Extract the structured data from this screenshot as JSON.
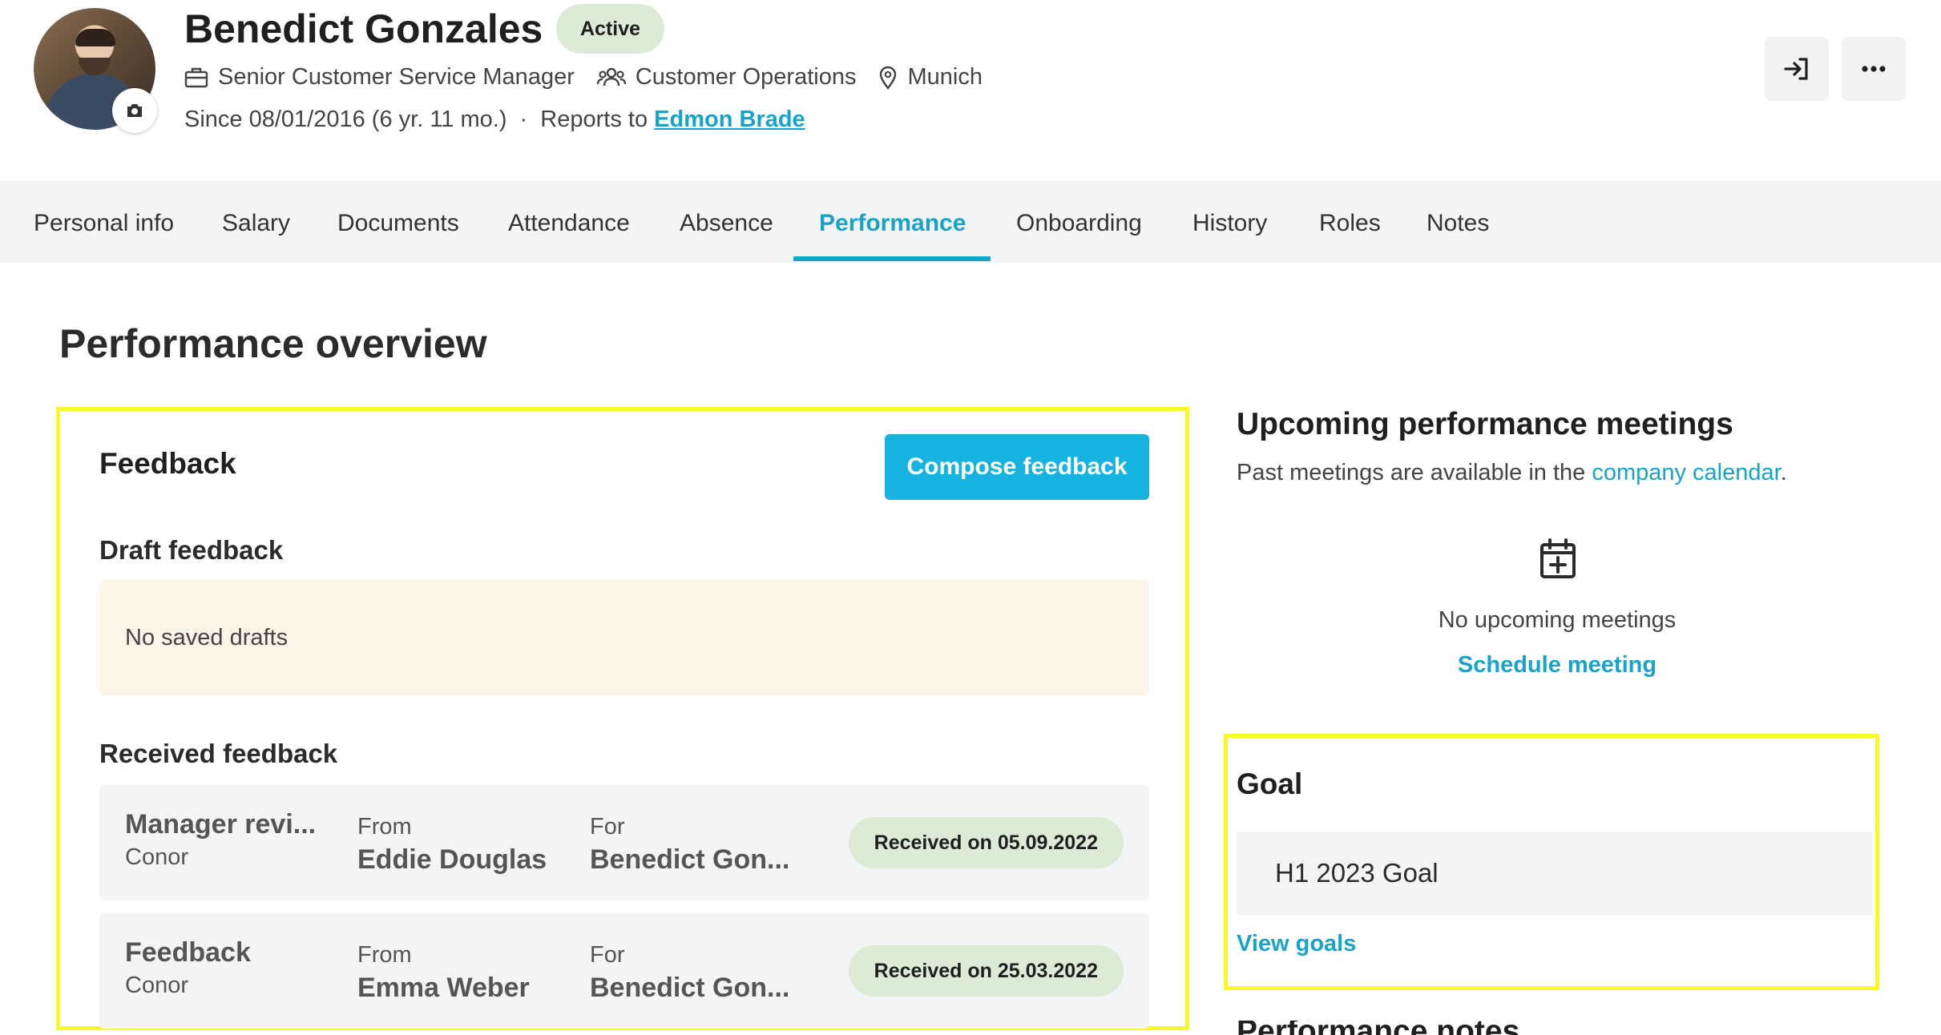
{
  "header": {
    "name": "Benedict Gonzales",
    "status": "Active",
    "job_title": "Senior Customer Service Manager",
    "department": "Customer Operations",
    "location": "Munich",
    "since_text": "Since 08/01/2016 (6 yr. 11 mo.)",
    "separator": "·",
    "reports_to_label": "Reports to",
    "reports_to_name": "Edmon Brade"
  },
  "tabs": [
    {
      "label": "Personal info"
    },
    {
      "label": "Salary"
    },
    {
      "label": "Documents"
    },
    {
      "label": "Attendance"
    },
    {
      "label": "Absence"
    },
    {
      "label": "Performance",
      "active": true
    },
    {
      "label": "Onboarding"
    },
    {
      "label": "History"
    },
    {
      "label": "Roles"
    },
    {
      "label": "Notes"
    }
  ],
  "page": {
    "title": "Performance overview"
  },
  "feedback": {
    "title": "Feedback",
    "compose_label": "Compose feedback",
    "draft_title": "Draft feedback",
    "no_drafts": "No saved drafts",
    "received_title": "Received feedback",
    "rows": [
      {
        "title": "Manager revi...",
        "subtitle": "Conor",
        "from_label": "From",
        "from": "Eddie Douglas",
        "for_label": "For",
        "for": "Benedict Gon...",
        "received": "Received on 05.09.2022"
      },
      {
        "title": "Feedback",
        "subtitle": "Conor",
        "from_label": "From",
        "from": "Emma Weber",
        "for_label": "For",
        "for": "Benedict Gon...",
        "received": "Received on 25.03.2022"
      }
    ]
  },
  "meetings": {
    "title": "Upcoming performance meetings",
    "sub_prefix": "Past meetings are available in the",
    "sub_link": "company calendar",
    "sub_suffix": ".",
    "empty": "No upcoming meetings",
    "schedule": "Schedule meeting"
  },
  "goal": {
    "title": "Goal",
    "item": "H1 2023 Goal",
    "view": "View goals"
  },
  "notes_section": {
    "title": "Performance notes"
  },
  "colors": {
    "accent": "#1aa3c8",
    "button": "#17b3e0",
    "badge": "#dcebd6",
    "highlight": "#f7f72a",
    "draft_bg": "#fdf4e8"
  }
}
